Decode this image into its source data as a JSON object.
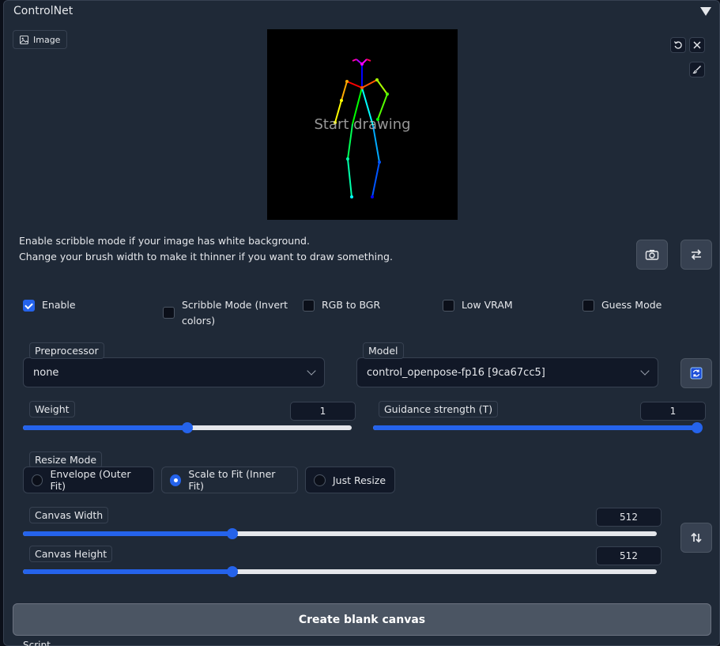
{
  "header": {
    "title": "ControlNet"
  },
  "image_tab": {
    "label": "Image",
    "icon": "image-icon"
  },
  "canvas": {
    "overlay_text": "Start drawing",
    "pose_colors": [
      "#ff0000",
      "#ff5500",
      "#ffaa00",
      "#ffff00",
      "#aaff00",
      "#55ff00",
      "#00ff00",
      "#00ff55",
      "#00ffaa",
      "#00ffff",
      "#00aaff",
      "#0055ff",
      "#0000ff",
      "#5500ff",
      "#aa00ff",
      "#ff00ff",
      "#ff00aa",
      "#ff0055"
    ]
  },
  "info": {
    "line1": "Enable scribble mode if your image has white background.",
    "line2": "Change your brush width to make it thinner if you want to draw something."
  },
  "checkboxes": [
    {
      "label": "Enable",
      "checked": true
    },
    {
      "label": "Scribble Mode (Invert",
      "label2": "colors)",
      "checked": false
    },
    {
      "label": "RGB to BGR",
      "checked": false
    },
    {
      "label": "Low VRAM",
      "checked": false
    },
    {
      "label": "Guess Mode",
      "checked": false
    }
  ],
  "preprocessor": {
    "label": "Preprocessor",
    "value": "none"
  },
  "model": {
    "label": "Model",
    "value": "control_openpose-fp16 [9ca67cc5]"
  },
  "weight": {
    "label": "Weight",
    "value": "1",
    "fraction": 0.5
  },
  "guidance": {
    "label": "Guidance strength (T)",
    "value": "1",
    "fraction": 1.0
  },
  "resize_mode": {
    "label": "Resize Mode",
    "options": [
      "Envelope (Outer Fit)",
      "Scale to Fit (Inner Fit)",
      "Just Resize"
    ],
    "selected": 1
  },
  "canvas_width": {
    "label": "Canvas Width",
    "value": "512",
    "fraction": 0.33
  },
  "canvas_height": {
    "label": "Canvas Height",
    "value": "512",
    "fraction": 0.33
  },
  "create_button": {
    "label": "Create blank canvas"
  },
  "script": {
    "label": "Script"
  },
  "accent": "#2563eb"
}
